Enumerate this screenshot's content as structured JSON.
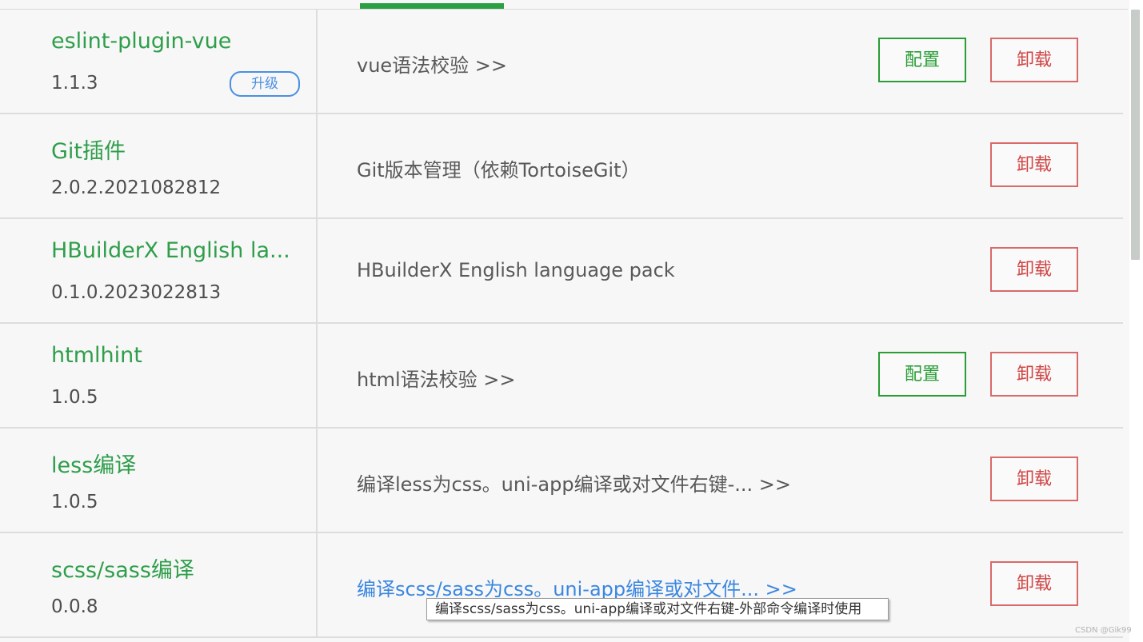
{
  "plugins": [
    {
      "name": "eslint-plugin-vue",
      "version": "1.1.3",
      "badge": "升级",
      "description": "vue语法校验 >>",
      "config_label": "配置",
      "uninstall_label": "卸载"
    },
    {
      "name": "Git插件",
      "version": "2.0.2.2021082812",
      "description": "Git版本管理（依赖TortoiseGit）",
      "uninstall_label": "卸载"
    },
    {
      "name": "HBuilderX English la...",
      "version": "0.1.0.2023022813",
      "description": "HBuilderX English language pack",
      "uninstall_label": "卸载"
    },
    {
      "name": "htmlhint",
      "version": "1.0.5",
      "description": "html语法校验 >>",
      "config_label": "配置",
      "uninstall_label": "卸载"
    },
    {
      "name": "less编译",
      "version": "1.0.5",
      "description": "编译less为css。uni-app编译或对文件右键-... >>",
      "uninstall_label": "卸载"
    },
    {
      "name": "scss/sass编译",
      "version": "0.0.8",
      "description": "编译scss/sass为css。uni-app编译或对文件... >>",
      "uninstall_label": "卸载"
    }
  ],
  "tooltip": "编译scss/sass为css。uni-app编译或对文件右键-外部命令编译时使用",
  "watermark": "CSDN @Gik99",
  "colors": {
    "plugin_name": "#2f9e4b",
    "config": "#2a9d35",
    "uninstall": "#d04545",
    "link": "#3b87e0",
    "tab_indicator": "#2aa043"
  }
}
